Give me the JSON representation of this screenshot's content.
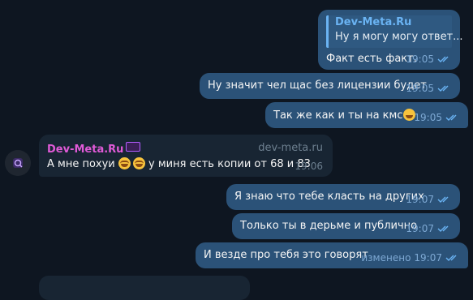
{
  "messages": {
    "m1": {
      "reply_name": "Dev-Meta.Ru",
      "reply_text": "Ну я могу могу ответ...",
      "text": "Факт есть факт.",
      "time": "19:05"
    },
    "m2": {
      "text": "Ну значит чел щас без лицензии будет",
      "time": "19:05"
    },
    "m3": {
      "text": "Так же как и ты на кмс",
      "time": "19:05"
    },
    "m4": {
      "sender": "Dev-Meta.Ru",
      "channel": "dev-meta.ru",
      "text_a": "А мне похуи",
      "text_b": "у миня есть копии от 68 и 83",
      "time": "19:06"
    },
    "m5": {
      "text": "Я знаю что тебе класть на других",
      "time": "19:07"
    },
    "m6": {
      "text": "Только ты в дерьме и публично",
      "time": "19:07"
    },
    "m7": {
      "text": "И везде про тебя это говорят",
      "edited": "изменено",
      "time": "19:07"
    }
  },
  "colors": {
    "background": "#0e1621",
    "outgoing_bubble": "#2b5278",
    "incoming_bubble": "#182533",
    "sender_name": "#e05ad7",
    "reply_accent": "#6ab3f3"
  },
  "icons": {
    "read_status": "double-check-icon",
    "avatar": "channel-avatar-icon",
    "emoji": "grinning-emoji-icon"
  }
}
